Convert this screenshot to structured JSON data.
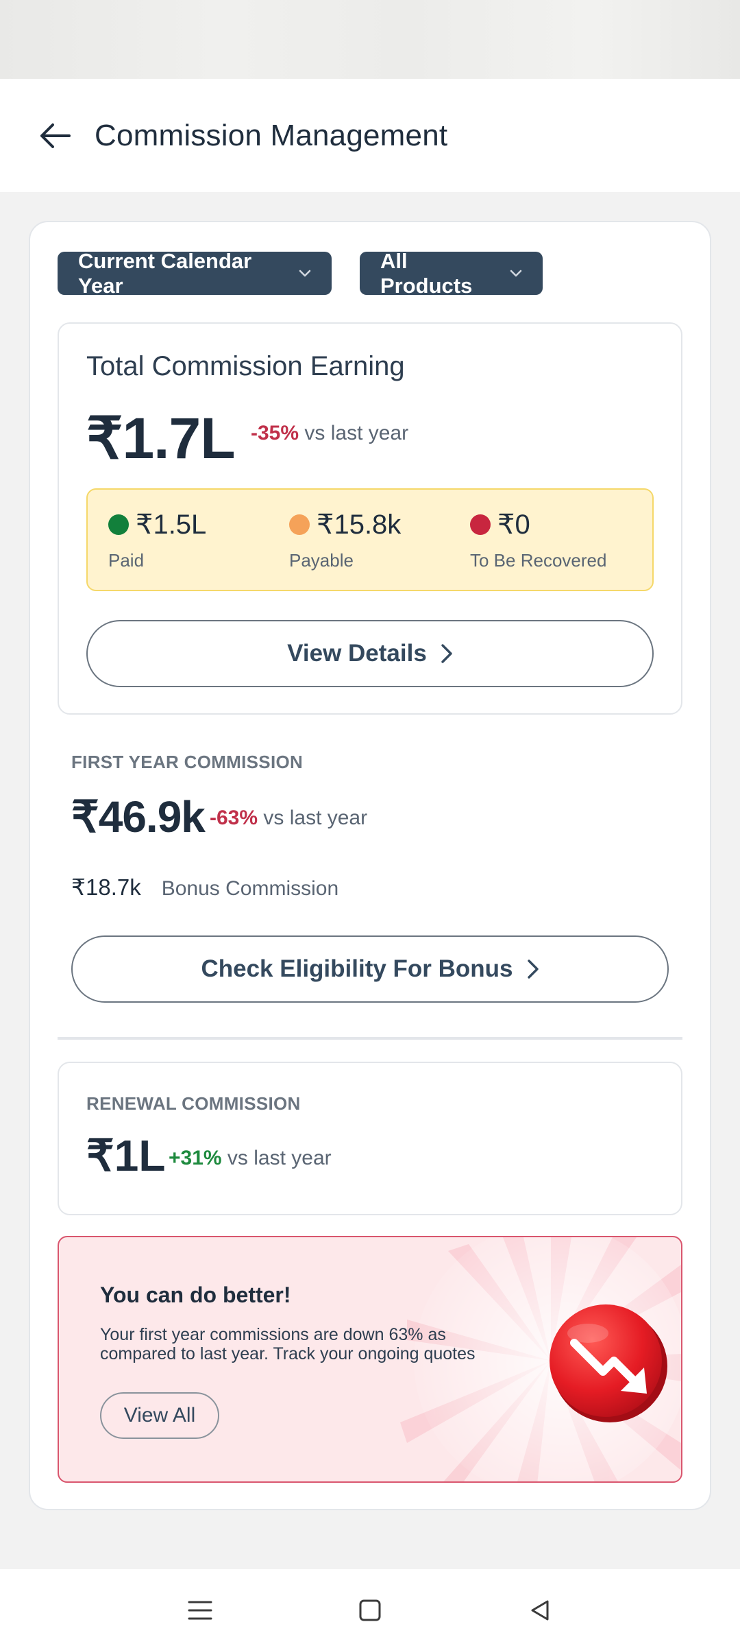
{
  "header": {
    "title": "Commission Management"
  },
  "filters": {
    "period": "Current Calendar Year",
    "products": "All Products"
  },
  "total": {
    "title": "Total Commission Earning",
    "amount": "₹1.7L",
    "delta": "-35%",
    "delta_suffix": "vs last year",
    "breakdown": [
      {
        "value": "₹1.5L",
        "label": "Paid",
        "color": "#12803b"
      },
      {
        "value": "₹15.8k",
        "label": "Payable",
        "color": "#f5a259"
      },
      {
        "value": "₹0",
        "label": "To Be Recovered",
        "color": "#c8263f"
      }
    ],
    "view_details_label": "View Details"
  },
  "first_year": {
    "label": "FIRST YEAR COMMISSION",
    "amount": "₹46.9k",
    "delta": "-63%",
    "delta_suffix": "vs last year",
    "bonus_amount": "₹18.7k",
    "bonus_label": "Bonus Commission",
    "check_button_label": "Check Eligibility For Bonus"
  },
  "renewal": {
    "label": "RENEWAL COMMISSION",
    "amount": "₹1L",
    "delta": "+31%",
    "delta_suffix": "vs last year"
  },
  "alert": {
    "title": "You can do better!",
    "body": "Your first year commissions are down 63% as compared to last year. Track your ongoing quotes",
    "button_label": "View All",
    "icon": "trend-down-icon"
  },
  "colors": {
    "primary": "#34495e",
    "negative": "#c0304a",
    "positive": "#1e8a3e",
    "highlight_bg": "#fff3cf",
    "alert_bg": "#fde8ea"
  }
}
